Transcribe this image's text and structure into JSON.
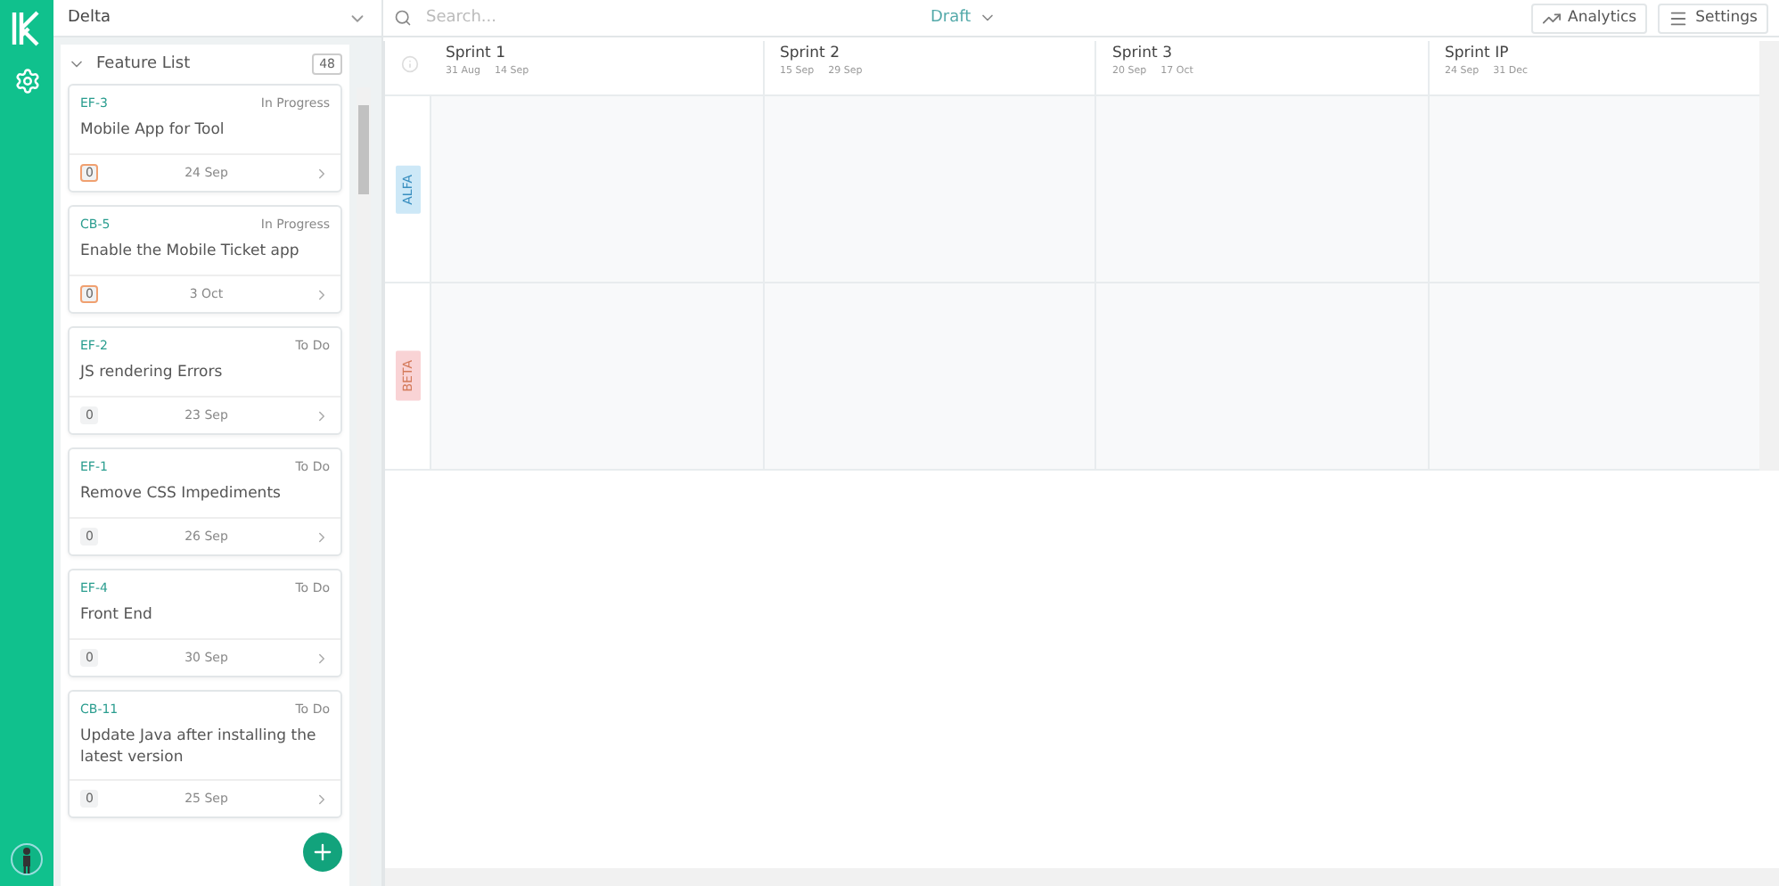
{
  "project_select": {
    "value": "Delta"
  },
  "feature_list": {
    "title": "Feature List",
    "count": "48",
    "expanded": true,
    "cards": [
      {
        "id": "EF-3",
        "status": "In Progress",
        "title": "Mobile App for Tool",
        "count": "0",
        "highlighted": true,
        "date": "24 Sep"
      },
      {
        "id": "CB-5",
        "status": "In Progress",
        "title": "Enable the Mobile Ticket app",
        "count": "0",
        "highlighted": true,
        "date": "3 Oct"
      },
      {
        "id": "EF-2",
        "status": "To Do",
        "title": "JS rendering Errors",
        "count": "0",
        "highlighted": false,
        "date": "23 Sep"
      },
      {
        "id": "EF-1",
        "status": "To Do",
        "title": "Remove CSS Impediments",
        "count": "0",
        "highlighted": false,
        "date": "26 Sep"
      },
      {
        "id": "EF-4",
        "status": "To Do",
        "title": "Front End",
        "count": "0",
        "highlighted": false,
        "date": "30 Sep"
      },
      {
        "id": "CB-11",
        "status": "To Do",
        "title": "Update Java after installing the latest version",
        "count": "0",
        "highlighted": false,
        "date": "25 Sep"
      }
    ]
  },
  "search": {
    "placeholder": "Search..."
  },
  "plan_select": {
    "value": "Draft"
  },
  "toolbar": [
    {
      "label": "Analytics",
      "kind": "analytics"
    },
    {
      "label": "Settings",
      "kind": "settings"
    }
  ],
  "sprints": [
    {
      "name": "Sprint 1",
      "start": "31 Aug",
      "end": "14 Sep"
    },
    {
      "name": "Sprint 2",
      "start": "15 Sep",
      "end": "29 Sep"
    },
    {
      "name": "Sprint 3",
      "start": "20 Sep",
      "end": "17 Oct"
    },
    {
      "name": "Sprint IP",
      "start": "24 Sep",
      "end": "31 Dec"
    }
  ],
  "teams": [
    {
      "name": "ALFA",
      "color": "#cde8f7"
    },
    {
      "name": "BETA",
      "color": "#f9d3d5"
    }
  ]
}
